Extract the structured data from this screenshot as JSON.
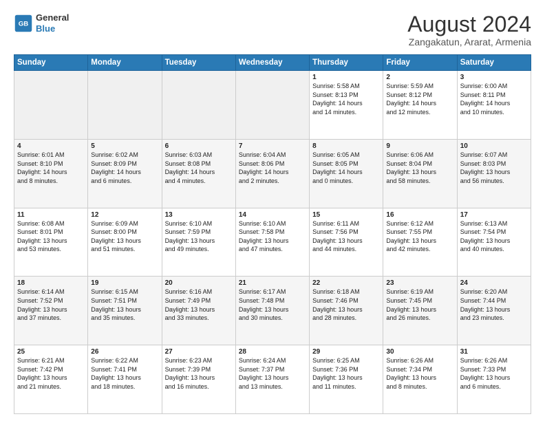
{
  "header": {
    "logo_line1": "General",
    "logo_line2": "Blue",
    "month_year": "August 2024",
    "location": "Zangakatun, Ararat, Armenia"
  },
  "weekdays": [
    "Sunday",
    "Monday",
    "Tuesday",
    "Wednesday",
    "Thursday",
    "Friday",
    "Saturday"
  ],
  "weeks": [
    [
      {
        "day": "",
        "info": ""
      },
      {
        "day": "",
        "info": ""
      },
      {
        "day": "",
        "info": ""
      },
      {
        "day": "",
        "info": ""
      },
      {
        "day": "1",
        "info": "Sunrise: 5:58 AM\nSunset: 8:13 PM\nDaylight: 14 hours\nand 14 minutes."
      },
      {
        "day": "2",
        "info": "Sunrise: 5:59 AM\nSunset: 8:12 PM\nDaylight: 14 hours\nand 12 minutes."
      },
      {
        "day": "3",
        "info": "Sunrise: 6:00 AM\nSunset: 8:11 PM\nDaylight: 14 hours\nand 10 minutes."
      }
    ],
    [
      {
        "day": "4",
        "info": "Sunrise: 6:01 AM\nSunset: 8:10 PM\nDaylight: 14 hours\nand 8 minutes."
      },
      {
        "day": "5",
        "info": "Sunrise: 6:02 AM\nSunset: 8:09 PM\nDaylight: 14 hours\nand 6 minutes."
      },
      {
        "day": "6",
        "info": "Sunrise: 6:03 AM\nSunset: 8:08 PM\nDaylight: 14 hours\nand 4 minutes."
      },
      {
        "day": "7",
        "info": "Sunrise: 6:04 AM\nSunset: 8:06 PM\nDaylight: 14 hours\nand 2 minutes."
      },
      {
        "day": "8",
        "info": "Sunrise: 6:05 AM\nSunset: 8:05 PM\nDaylight: 14 hours\nand 0 minutes."
      },
      {
        "day": "9",
        "info": "Sunrise: 6:06 AM\nSunset: 8:04 PM\nDaylight: 13 hours\nand 58 minutes."
      },
      {
        "day": "10",
        "info": "Sunrise: 6:07 AM\nSunset: 8:03 PM\nDaylight: 13 hours\nand 56 minutes."
      }
    ],
    [
      {
        "day": "11",
        "info": "Sunrise: 6:08 AM\nSunset: 8:01 PM\nDaylight: 13 hours\nand 53 minutes."
      },
      {
        "day": "12",
        "info": "Sunrise: 6:09 AM\nSunset: 8:00 PM\nDaylight: 13 hours\nand 51 minutes."
      },
      {
        "day": "13",
        "info": "Sunrise: 6:10 AM\nSunset: 7:59 PM\nDaylight: 13 hours\nand 49 minutes."
      },
      {
        "day": "14",
        "info": "Sunrise: 6:10 AM\nSunset: 7:58 PM\nDaylight: 13 hours\nand 47 minutes."
      },
      {
        "day": "15",
        "info": "Sunrise: 6:11 AM\nSunset: 7:56 PM\nDaylight: 13 hours\nand 44 minutes."
      },
      {
        "day": "16",
        "info": "Sunrise: 6:12 AM\nSunset: 7:55 PM\nDaylight: 13 hours\nand 42 minutes."
      },
      {
        "day": "17",
        "info": "Sunrise: 6:13 AM\nSunset: 7:54 PM\nDaylight: 13 hours\nand 40 minutes."
      }
    ],
    [
      {
        "day": "18",
        "info": "Sunrise: 6:14 AM\nSunset: 7:52 PM\nDaylight: 13 hours\nand 37 minutes."
      },
      {
        "day": "19",
        "info": "Sunrise: 6:15 AM\nSunset: 7:51 PM\nDaylight: 13 hours\nand 35 minutes."
      },
      {
        "day": "20",
        "info": "Sunrise: 6:16 AM\nSunset: 7:49 PM\nDaylight: 13 hours\nand 33 minutes."
      },
      {
        "day": "21",
        "info": "Sunrise: 6:17 AM\nSunset: 7:48 PM\nDaylight: 13 hours\nand 30 minutes."
      },
      {
        "day": "22",
        "info": "Sunrise: 6:18 AM\nSunset: 7:46 PM\nDaylight: 13 hours\nand 28 minutes."
      },
      {
        "day": "23",
        "info": "Sunrise: 6:19 AM\nSunset: 7:45 PM\nDaylight: 13 hours\nand 26 minutes."
      },
      {
        "day": "24",
        "info": "Sunrise: 6:20 AM\nSunset: 7:44 PM\nDaylight: 13 hours\nand 23 minutes."
      }
    ],
    [
      {
        "day": "25",
        "info": "Sunrise: 6:21 AM\nSunset: 7:42 PM\nDaylight: 13 hours\nand 21 minutes."
      },
      {
        "day": "26",
        "info": "Sunrise: 6:22 AM\nSunset: 7:41 PM\nDaylight: 13 hours\nand 18 minutes."
      },
      {
        "day": "27",
        "info": "Sunrise: 6:23 AM\nSunset: 7:39 PM\nDaylight: 13 hours\nand 16 minutes."
      },
      {
        "day": "28",
        "info": "Sunrise: 6:24 AM\nSunset: 7:37 PM\nDaylight: 13 hours\nand 13 minutes."
      },
      {
        "day": "29",
        "info": "Sunrise: 6:25 AM\nSunset: 7:36 PM\nDaylight: 13 hours\nand 11 minutes."
      },
      {
        "day": "30",
        "info": "Sunrise: 6:26 AM\nSunset: 7:34 PM\nDaylight: 13 hours\nand 8 minutes."
      },
      {
        "day": "31",
        "info": "Sunrise: 6:26 AM\nSunset: 7:33 PM\nDaylight: 13 hours\nand 6 minutes."
      }
    ]
  ]
}
